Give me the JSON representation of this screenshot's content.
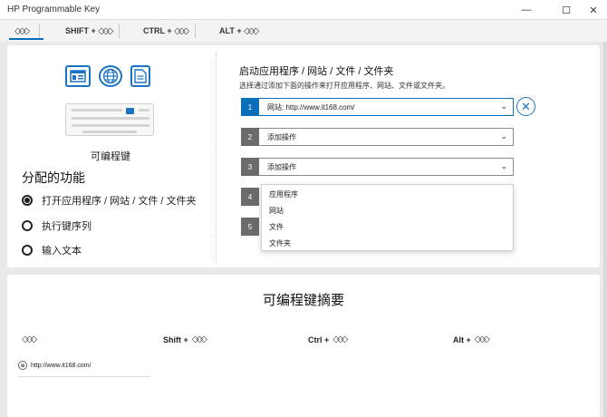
{
  "window": {
    "title": "HP Programmable Key",
    "minimize_icon": "minimize-icon",
    "maximize_icon": "maximize-icon",
    "close_icon": "close-icon"
  },
  "tabs": [
    {
      "label": "",
      "selected": true
    },
    {
      "label": "SHIFT +",
      "selected": false
    },
    {
      "label": "CTRL +",
      "selected": false
    },
    {
      "label": "ALT +",
      "selected": false
    }
  ],
  "left": {
    "app_icons": [
      "window-app-icon",
      "globe-icon",
      "document-icon"
    ],
    "keyboard_caption": "可编程键",
    "assign_title": "分配的功能",
    "options": [
      {
        "label": "打开应用程序 / 网站 / 文件 / 文件夹",
        "selected": true
      },
      {
        "label": "执行键序列",
        "selected": false
      },
      {
        "label": "输入文本",
        "selected": false
      }
    ]
  },
  "right": {
    "title": "启动应用程序 / 网站 / 文件 / 文件夹",
    "description": "选择通过添加下面的操作来打开应用程序、网站、文件或文件夹。",
    "actions": [
      {
        "num": "1",
        "value": "网站: http://www.it168.com/",
        "active": true
      },
      {
        "num": "2",
        "value": "添加操作",
        "active": false
      },
      {
        "num": "3",
        "value": "添加操作",
        "active": false
      },
      {
        "num": "4",
        "value": "",
        "active": false
      },
      {
        "num": "5",
        "value": "",
        "active": false
      }
    ],
    "dropdown_options": [
      "应用程序",
      "网站",
      "文件",
      "文件夹"
    ]
  },
  "summary": {
    "title": "可编程键摘要",
    "columns": [
      "",
      "Shift +",
      "Ctrl +",
      "Alt +"
    ],
    "entry": "http://www.it168.com/"
  },
  "colors": {
    "accent": "#0a6fb8",
    "icon_blue": "#1a73c2"
  }
}
